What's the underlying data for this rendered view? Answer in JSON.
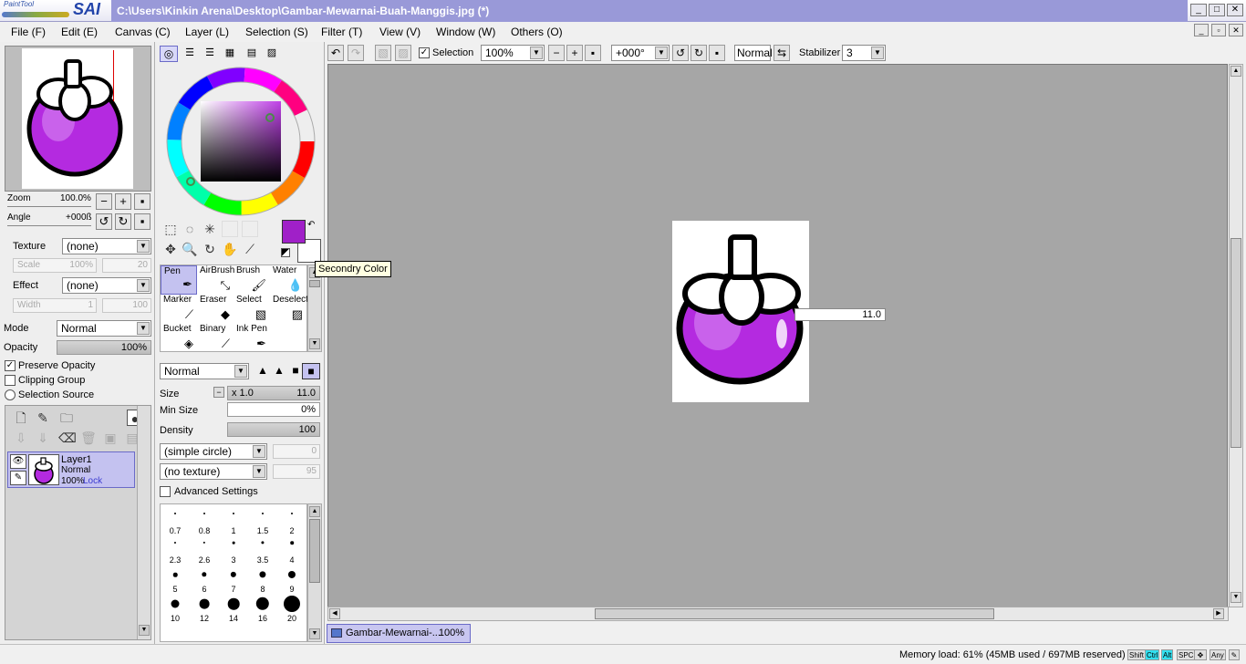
{
  "window": {
    "title": "C:\\Users\\Kinkin Arena\\Desktop\\Gambar-Mewarnai-Buah-Manggis.jpg (*)",
    "logo_small": "PaintTool",
    "logo_big": "SAI"
  },
  "menu": [
    "File (F)",
    "Edit (E)",
    "Canvas (C)",
    "Layer (L)",
    "Selection (S)",
    "Filter (T)",
    "View (V)",
    "Window (W)",
    "Others (O)"
  ],
  "navigator": {
    "zoom_label": "Zoom",
    "zoom_value": "100.0%",
    "angle_label": "Angle",
    "angle_value": "+000ß"
  },
  "texture": {
    "label": "Texture",
    "value": "(none)",
    "scale_label": "Scale",
    "scale_value": "100%",
    "scale_num": "20"
  },
  "effect": {
    "label": "Effect",
    "value": "(none)",
    "width_label": "Width",
    "width_value": "1",
    "width_num": "100"
  },
  "layer_props": {
    "mode_label": "Mode",
    "mode_value": "Normal",
    "opacity_label": "Opacity",
    "opacity_value": "100%",
    "preserve_opacity": "Preserve Opacity",
    "clipping_group": "Clipping Group",
    "selection_source": "Selection Source"
  },
  "layer": {
    "name": "Layer1",
    "mode": "Normal",
    "opacity": "100%",
    "lock": "Lock"
  },
  "colors": {
    "primary": "#a020c8",
    "secondary": "#ffffff",
    "accent": "#9999d8",
    "layer_highlight": "#c4c2f0",
    "key_on": "#33e0f0"
  },
  "tools": [
    {
      "label": "Pen",
      "icon": "pen-icon"
    },
    {
      "label": "AirBrush",
      "icon": "airbrush-icon"
    },
    {
      "label": "Brush",
      "icon": "brush-icon"
    },
    {
      "label": "Water",
      "icon": "water-icon"
    },
    {
      "label": "Marker",
      "icon": "marker-icon"
    },
    {
      "label": "Eraser",
      "icon": "eraser-icon"
    },
    {
      "label": "Select",
      "icon": "select-icon"
    },
    {
      "label": "Deselect",
      "icon": "deselect-icon"
    },
    {
      "label": "Bucket",
      "icon": "bucket-icon"
    },
    {
      "label": "Binary",
      "icon": "binary-icon"
    },
    {
      "label": "Ink Pen",
      "icon": "ink-pen-icon"
    }
  ],
  "brush": {
    "blend": "Normal",
    "size_label": "Size",
    "size_mult": "x 1.0",
    "size_value": "11.0",
    "min_size_label": "Min Size",
    "min_size_value": "0%",
    "density_label": "Density",
    "density_value": "100",
    "shape": "(simple circle)",
    "shape_num": "0",
    "texture": "(no texture)",
    "texture_num": "95",
    "advanced": "Advanced Settings",
    "sizes": [
      "0.7",
      "0.8",
      "1",
      "1.5",
      "2",
      "2.3",
      "2.6",
      "3",
      "3.5",
      "4",
      "5",
      "6",
      "7",
      "8",
      "9",
      "10",
      "12",
      "14",
      "16",
      "20"
    ]
  },
  "tooltip": "Secondry Color",
  "canvas_toolbar": {
    "selection_label": "Selection",
    "zoom": "100%",
    "angle": "+000°",
    "blend": "Normal",
    "stabilizer_label": "Stabilizer",
    "stabilizer_value": "3"
  },
  "canvas": {
    "size_readout": "11.0"
  },
  "doc_tab": {
    "name": "Gambar-Mewarnai-...",
    "zoom": "100%"
  },
  "status": {
    "memory": "Memory load: 61% (45MB used / 697MB reserved)",
    "keys": [
      "Shift",
      "Ctrl",
      "Alt",
      "SPC",
      "Any"
    ]
  }
}
